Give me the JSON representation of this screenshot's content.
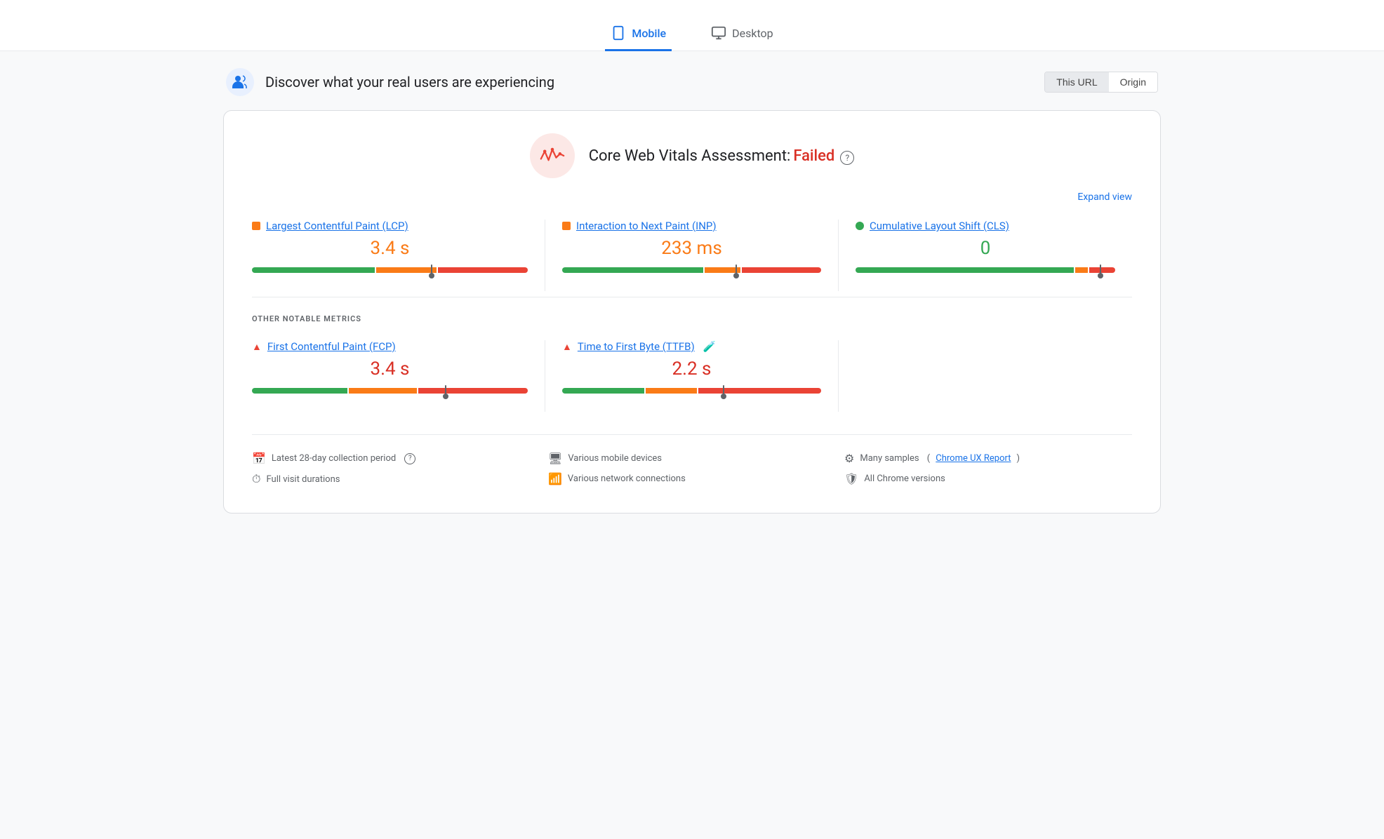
{
  "tabs": [
    {
      "id": "mobile",
      "label": "Mobile",
      "active": true
    },
    {
      "id": "desktop",
      "label": "Desktop",
      "active": false
    }
  ],
  "section": {
    "title": "Discover what your real users are experiencing",
    "url_toggle": {
      "this_url": "This URL",
      "origin": "Origin"
    }
  },
  "cwv": {
    "assessment_label": "Core Web Vitals Assessment:",
    "status": "Failed",
    "help_icon": "?",
    "expand_label": "Expand view",
    "metrics": [
      {
        "id": "lcp",
        "label": "Largest Contentful Paint (LCP)",
        "indicator_type": "square",
        "indicator_color": "orange",
        "value": "3.4 s",
        "value_color": "orange",
        "bar": {
          "green": 45,
          "orange": 22,
          "red": 33,
          "marker_pct": 66
        }
      },
      {
        "id": "inp",
        "label": "Interaction to Next Paint (INP)",
        "indicator_type": "square",
        "indicator_color": "orange",
        "value": "233 ms",
        "value_color": "orange",
        "bar": {
          "green": 55,
          "orange": 14,
          "red": 31,
          "marker_pct": 67
        }
      },
      {
        "id": "cls",
        "label": "Cumulative Layout Shift (CLS)",
        "indicator_type": "circle",
        "indicator_color": "green",
        "value": "0",
        "value_color": "green",
        "bar": {
          "green": 85,
          "orange": 5,
          "red": 10,
          "marker_pct": 95
        }
      }
    ]
  },
  "other_metrics": {
    "label": "OTHER NOTABLE METRICS",
    "metrics": [
      {
        "id": "fcp",
        "label": "First Contentful Paint (FCP)",
        "icon": "triangle",
        "value": "3.4 s",
        "value_color": "red",
        "bar": {
          "green": 35,
          "orange": 25,
          "red": 40,
          "marker_pct": 70
        }
      },
      {
        "id": "ttfb",
        "label": "Time to First Byte (TTFB)",
        "icon": "triangle",
        "has_beaker": true,
        "value": "2.2 s",
        "value_color": "red",
        "bar": {
          "green": 32,
          "orange": 20,
          "red": 48,
          "marker_pct": 63
        }
      }
    ]
  },
  "footer": {
    "col1": [
      {
        "icon": "calendar",
        "text": "Latest 28-day collection period",
        "has_help": true
      },
      {
        "icon": "clock",
        "text": "Full visit durations"
      }
    ],
    "col2": [
      {
        "icon": "monitor",
        "text": "Various mobile devices"
      },
      {
        "icon": "wifi",
        "text": "Various network connections"
      }
    ],
    "col3": [
      {
        "icon": "dots",
        "text": "Many samples",
        "link_text": "Chrome UX Report",
        "link_href": "#"
      },
      {
        "icon": "shield",
        "text": "All Chrome versions"
      }
    ]
  }
}
